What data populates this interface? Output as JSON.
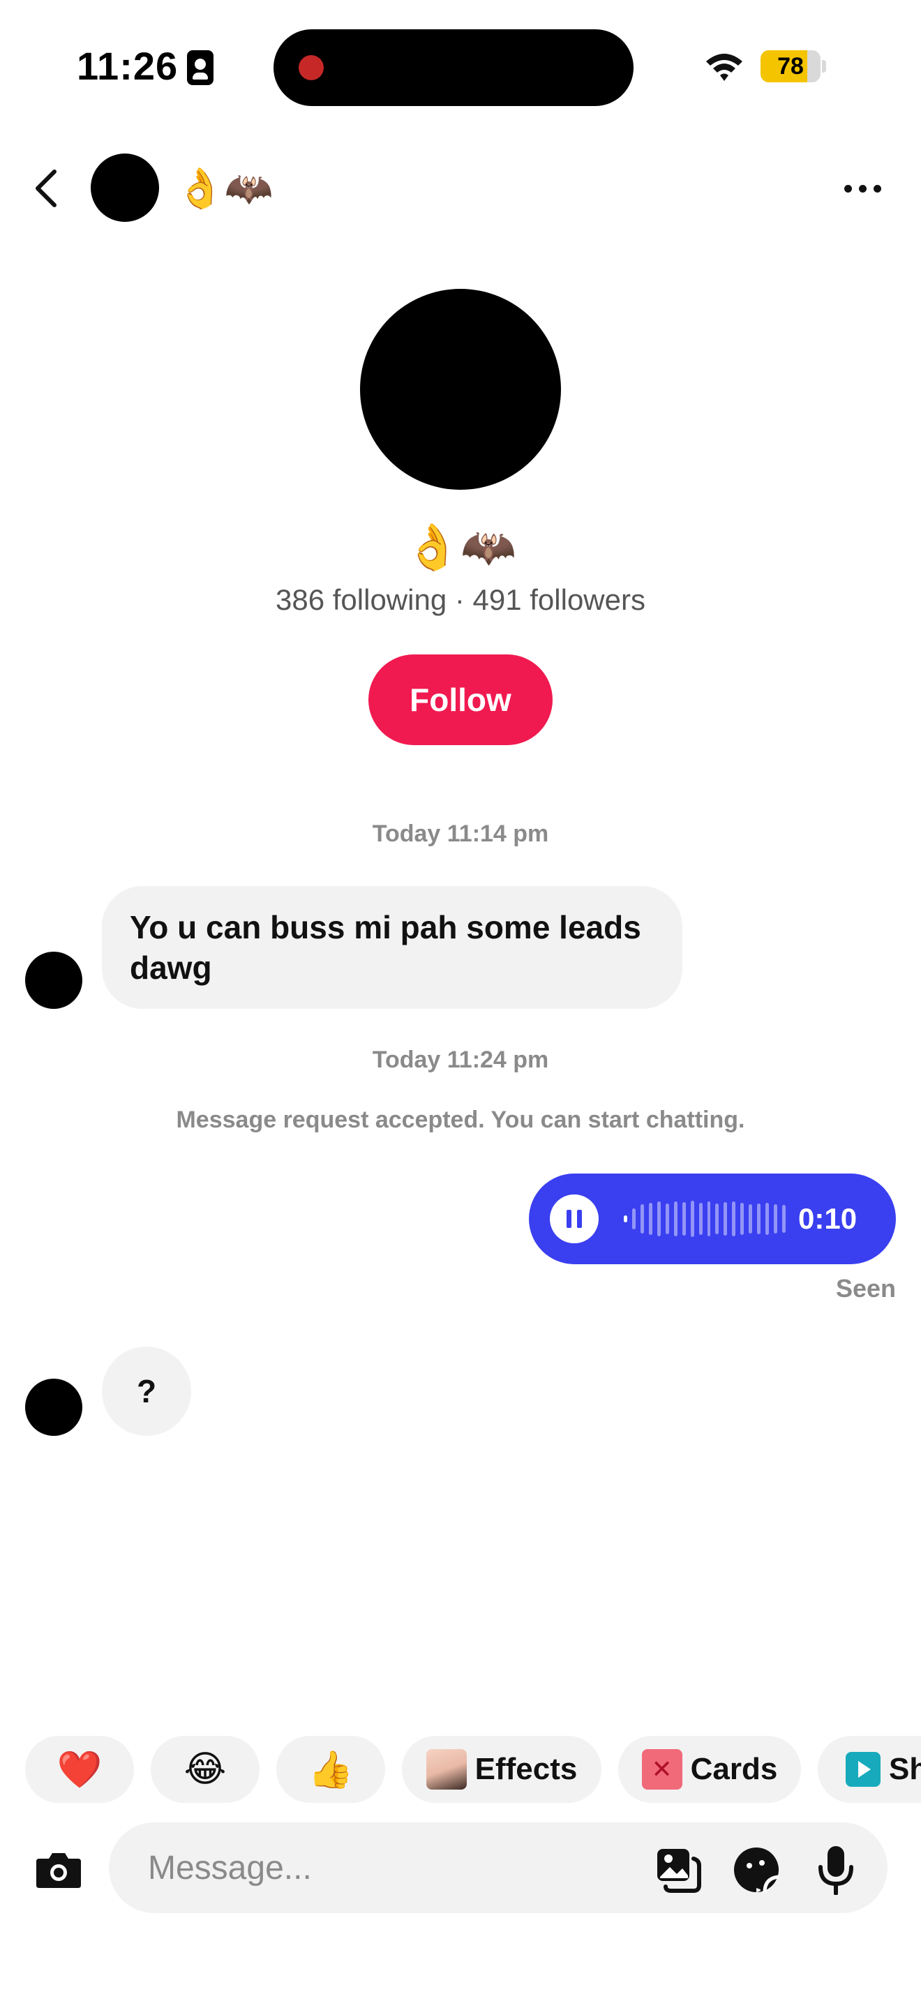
{
  "status_bar": {
    "time": "11:26",
    "battery_level": "78",
    "battery_fraction": 0.78
  },
  "header": {
    "name": "👌🦇",
    "icons": [
      "back-arrow-icon",
      "more-dots-icon"
    ]
  },
  "profile": {
    "name": "👌🦇",
    "stats": "386 following · 491 followers",
    "follow_label": "Follow"
  },
  "conversation": {
    "timestamp_1": "Today 11:14 pm",
    "message_1": "Yo u can buss mi pah some leads dawg",
    "timestamp_2": "Today 11:24 pm",
    "system_message": "Message request accepted. You can start chatting.",
    "voice_message": {
      "duration": "0:10",
      "played_fraction": 0.05
    },
    "seen_label": "Seen",
    "message_2": "?"
  },
  "quick_actions": {
    "reaction_1": "❤️",
    "reaction_2": "😂",
    "reaction_3": "👍",
    "effects_label": "Effects",
    "cards_label": "Cards",
    "share_label": "Sh"
  },
  "composer": {
    "placeholder": "Message...",
    "icons": [
      "camera-icon",
      "gallery-icon",
      "sticker-icon",
      "microphone-icon"
    ]
  },
  "colors": {
    "follow": "#f01a50",
    "voice_bubble": "#3a3ff0",
    "battery": "#f5c400",
    "recording_dot": "#c62828"
  }
}
